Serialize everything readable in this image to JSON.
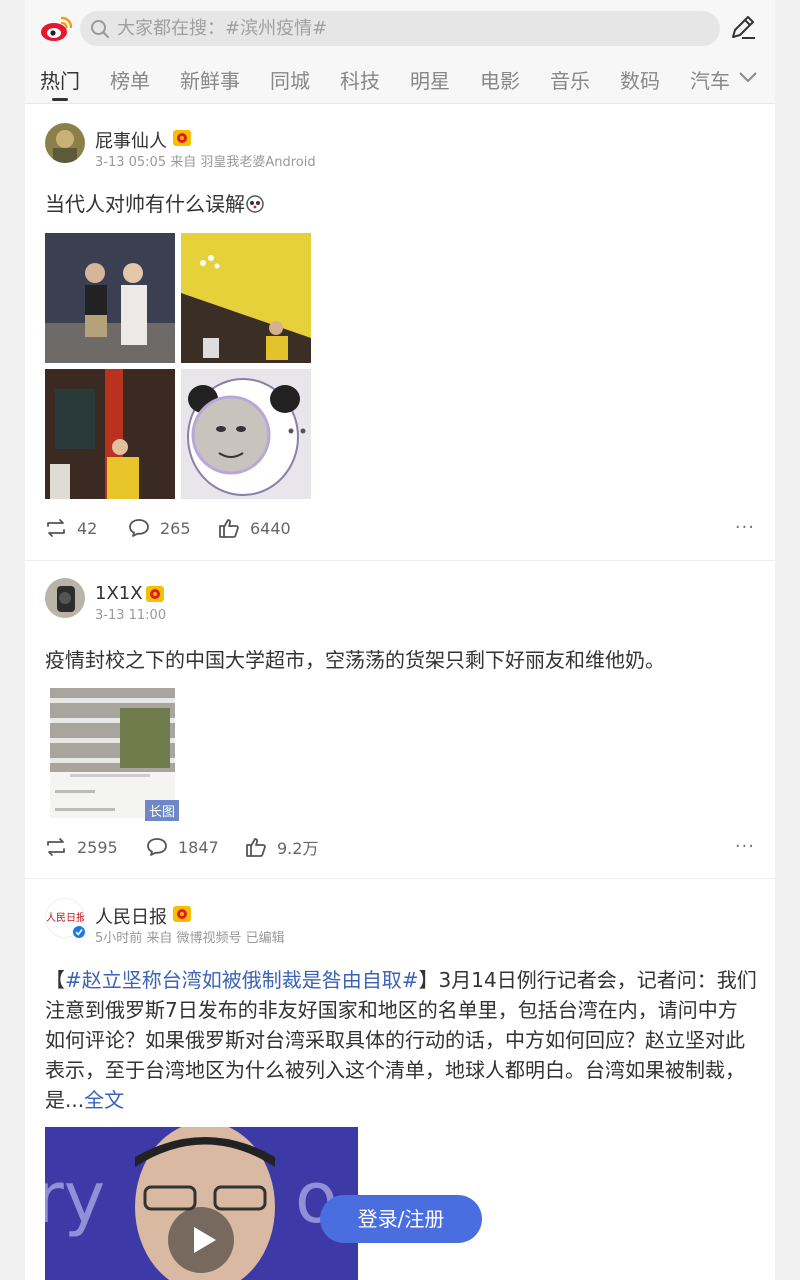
{
  "search": {
    "placeholder": "大家都在搜：#滨州疫情#"
  },
  "tabs": [
    "热门",
    "榜单",
    "新鲜事",
    "同城",
    "科技",
    "明星",
    "电影",
    "音乐",
    "数码",
    "汽车"
  ],
  "posts": [
    {
      "username": "屁事仙人",
      "meta": "3-13 05:05 来自 羽皇我老婆Android",
      "text": "当代人对帅有什么误解",
      "reposts": "42",
      "comments": "265",
      "likes": "6440"
    },
    {
      "username": "1X1X",
      "meta": "3-13 11:00",
      "text": "疫情封校之下的中国大学超市，空荡荡的货架只剩下好丽友和维他奶。",
      "image_badge": "长图",
      "reposts": "2595",
      "comments": "1847",
      "likes": "9.2万"
    },
    {
      "username": "人民日报",
      "meta": "5小时前 来自 微博视频号 已编辑",
      "text_prefix": "【",
      "hashtag": "#赵立坚称台湾如被俄制裁是咎由自取#",
      "text_body": "】3月14日例行记者会，记者问：我们注意到俄罗斯7日发布的非友好国家和地区的名单里，包括台湾在内，请问中方如何评论？如果俄罗斯对台湾采取具体的行动的话，中方如何回应？赵立坚对此表示，至于台湾地区为什么被列入这个清单，地球人都明白。台湾如果被制裁，是...",
      "full_text_link": "全文"
    }
  ],
  "login_button": "登录/注册",
  "more_label": "···",
  "colors": {
    "accent": "#4a6ee0",
    "link": "#3b63b5",
    "vip": "#f5c000"
  }
}
